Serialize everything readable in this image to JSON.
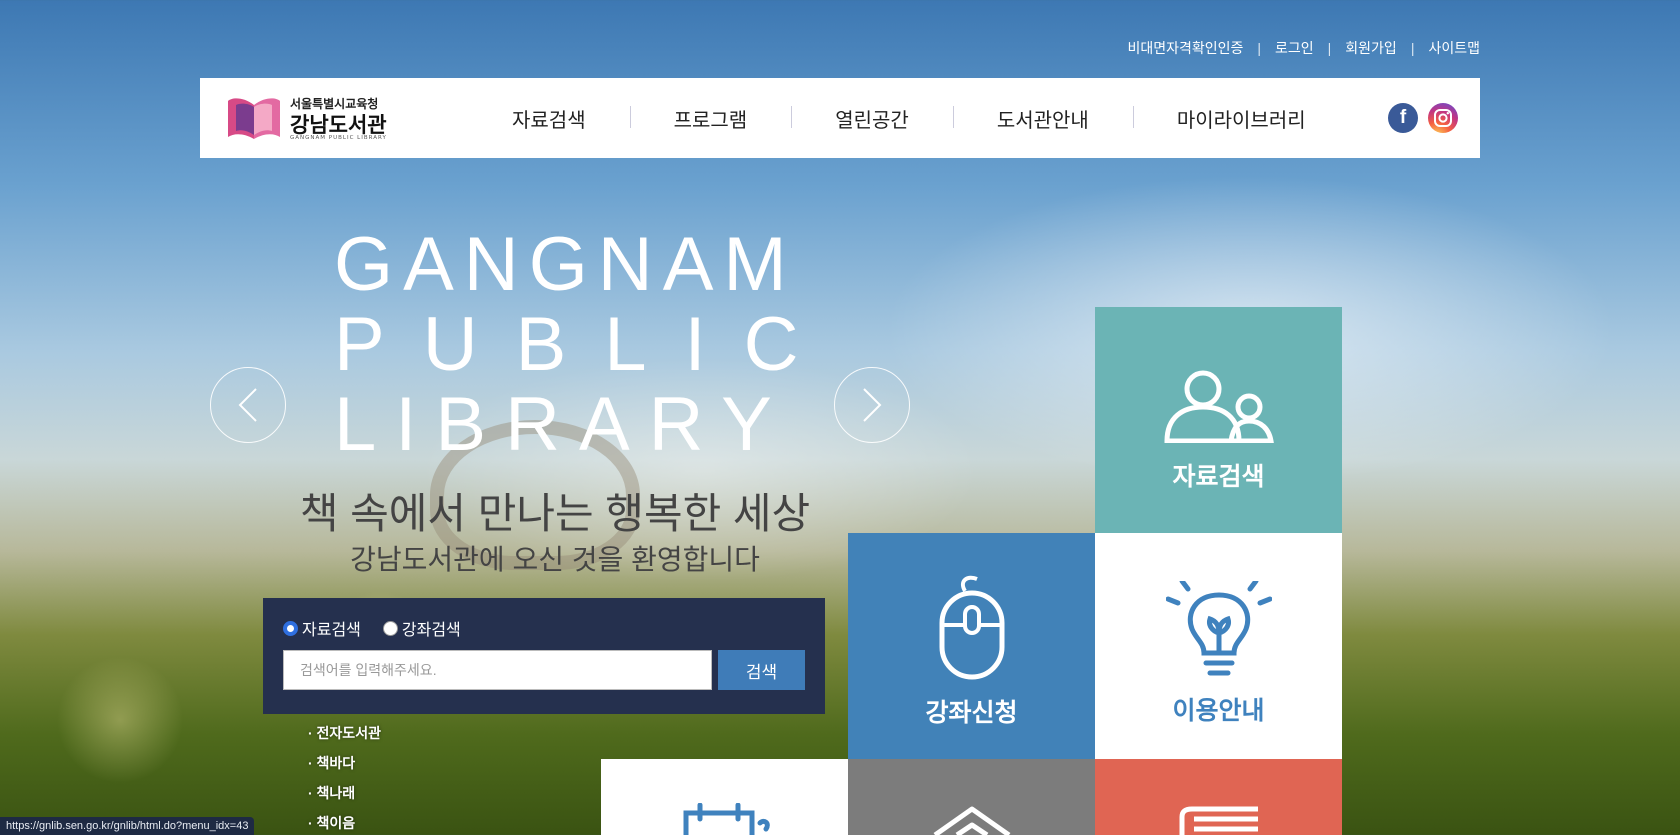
{
  "util_nav": [
    "비대면자격확인인증",
    "로그인",
    "회원가입",
    "사이트맵"
  ],
  "logo": {
    "line1": "서울특별시교육청",
    "line2": "강남도서관",
    "line3": "GANGNAM PUBLIC LIBRARY"
  },
  "gnb": [
    "자료검색",
    "프로그램",
    "열린공간",
    "도서관안내",
    "마이라이브러리"
  ],
  "sns": {
    "facebook": "f"
  },
  "hero": {
    "title_lines": [
      "GANGNAM",
      "PUBLIC",
      "LIBRARY"
    ],
    "slogan": "책 속에서 만나는 행복한 세상",
    "welcome": "강남도서관에 오신 것을 환영합니다"
  },
  "search": {
    "radio1": "자료검색",
    "radio2": "강좌검색",
    "placeholder": "검색어를 입력해주세요.",
    "button": "검색"
  },
  "quick_links": [
    "· 전자도서관",
    "· 책바다",
    "· 책나래",
    "· 책이음"
  ],
  "tiles": {
    "search": "자료검색",
    "course": "강좌신청",
    "info": "이용안내"
  },
  "colors": {
    "teal": "#6bb4b5",
    "blue": "#4182b8",
    "navy": "#25304e",
    "coral": "#e06553",
    "gray": "#7c7c7c"
  },
  "status_url": "https://gnlib.sen.go.kr/gnlib/html.do?menu_idx=43"
}
